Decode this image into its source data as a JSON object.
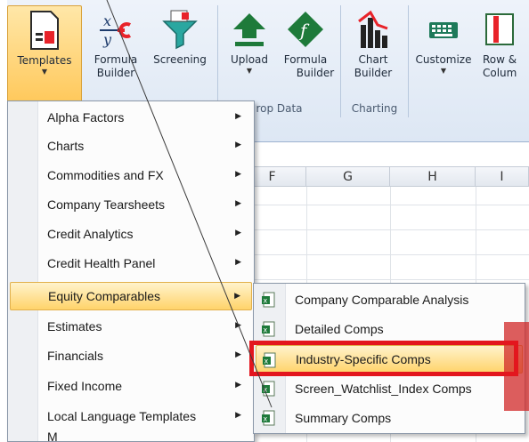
{
  "ribbon": {
    "buttons": [
      {
        "label": "Templates",
        "icon": "templates-icon"
      },
      {
        "label": "Formula",
        "label2": "Builder",
        "icon": "formula-builder-icon"
      },
      {
        "label": "Screening",
        "icon": "screening-funnel-icon"
      },
      {
        "label": "Upload",
        "icon": "upload-arrow-icon"
      },
      {
        "label": "Formula",
        "label2": "Builder",
        "icon": "formula-f-icon"
      },
      {
        "label": "Chart",
        "label2": "Builder",
        "icon": "chart-builder-icon"
      },
      {
        "label": "Customize",
        "icon": "keyboard-icon"
      },
      {
        "label": "Row &",
        "label2": "Colum",
        "icon": "row-column-icon"
      }
    ],
    "groups": {
      "drop_data": "rop Data",
      "charting": "Charting"
    }
  },
  "sheet": {
    "columns": [
      "F",
      "G",
      "H",
      "I"
    ]
  },
  "menu": {
    "items": [
      "Alpha Factors",
      "Charts",
      "Commodities and FX",
      "Company Tearsheets",
      "Credit Analytics",
      "Credit Health Panel",
      "Equity Comparables",
      "Estimates",
      "Financials",
      "Fixed Income",
      "Local Language Templates",
      "M"
    ],
    "active_index": 6
  },
  "submenu": {
    "items": [
      "Company Comparable Analysis",
      "Detailed Comps",
      "Industry-Specific Comps",
      "Screen_Watchlist_Index Comps",
      "Summary Comps"
    ],
    "active_index": 2
  },
  "colors": {
    "highlight": "#e3161e",
    "menu_active": "#ffd36a",
    "ribbon": "#dde7f4"
  }
}
